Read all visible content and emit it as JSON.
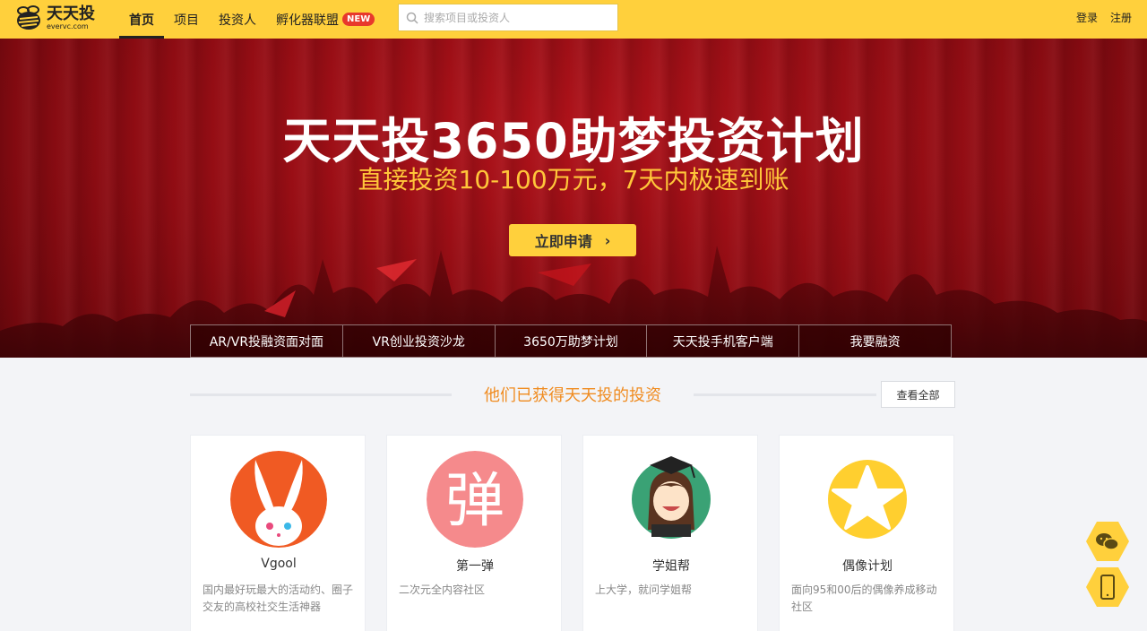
{
  "header": {
    "logo_cn": "天天投",
    "logo_en": "evervc.com",
    "nav": [
      {
        "label": "首页",
        "active": true
      },
      {
        "label": "项目"
      },
      {
        "label": "投资人"
      },
      {
        "label": "孵化器联盟",
        "badge": "NEW"
      }
    ],
    "search_placeholder": "搜索项目或投资人",
    "login": "登录",
    "register": "注册"
  },
  "banner": {
    "title": "天天投3650助梦投资计划",
    "subtitle": "直接投资10-100万元，7天内极速到账",
    "apply_label": "立即申请",
    "tabs": [
      "AR/VR投融资面对面",
      "VR创业投资沙龙",
      "3650万助梦计划",
      "天天投手机客户端",
      "我要融资"
    ]
  },
  "section": {
    "title": "他们已获得天天投的投资",
    "view_all": "查看全部"
  },
  "cards": [
    {
      "name": "Vgool",
      "desc": "国内最好玩最大的活动约、圈子交友的高校社交生活神器",
      "logo": "rabbit-logo",
      "color": "#f05a23"
    },
    {
      "name": "第一弹",
      "desc": "二次元全内容社区",
      "logo": "dan-logo",
      "glyph": "弹",
      "color": "#f58a8c"
    },
    {
      "name": "学姐帮",
      "desc": "上大学，就问学姐帮",
      "logo": "graduate-girl-logo",
      "color": "#3aa275"
    },
    {
      "name": "偶像计划",
      "desc": "面向95和00后的偶像养成移动社区",
      "logo": "star-logo",
      "color": "#ffcf2f"
    }
  ],
  "floating": {
    "wechat_icon": "wechat-icon",
    "mobile_icon": "mobile-phone-icon",
    "color": "#ffd03c"
  }
}
